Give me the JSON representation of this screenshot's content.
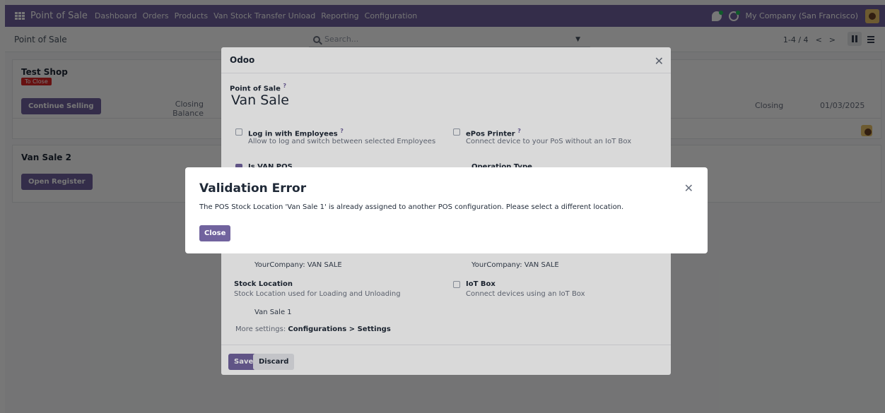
{
  "navbar": {
    "brand": "Point of Sale",
    "menu": [
      "Dashboard",
      "Orders",
      "Products",
      "Van Stock Transfer Unload",
      "Reporting",
      "Configuration"
    ],
    "company": "My Company (San Francisco)"
  },
  "control_panel": {
    "title": "Point of Sale",
    "search_placeholder": "Search...",
    "pager": "1-4 / 4"
  },
  "kanban": {
    "card1": {
      "name": "Test Shop",
      "badge": "To Close",
      "button": "Continue Selling",
      "closing_balance": "Closing Balance",
      "closing": "Closing",
      "date": "01/03/2025"
    },
    "card2": {
      "name": "Van Sale 2",
      "button": "Open Register"
    }
  },
  "form_dialog": {
    "title": "Odoo",
    "field_label": "Point of Sale",
    "name": "Van Sale",
    "options": {
      "log_in_title": "Log in with Employees",
      "log_in_desc": "Allow to log and switch between selected Employees",
      "epos_title": "ePos Printer",
      "epos_desc": "Connect device to your PoS without an IoT Box",
      "is_van_pos": "Is VAN POS",
      "operation_type": "Operation Type",
      "stock_location_title": "Stock Location",
      "stock_location_desc": "Stock Location used for Loading and Unloading",
      "iot_title": "IoT Box",
      "iot_desc": "Connect devices using an IoT Box"
    },
    "left_value": "YourCompany: VAN SALE",
    "right_value": "YourCompany: VAN SALE",
    "stock_location_value": "Van Sale 1",
    "more_settings_prefix": "More settings:",
    "more_settings_link": "Configurations > Settings",
    "save": "Save",
    "discard": "Discard"
  },
  "error_dialog": {
    "title": "Validation Error",
    "message": "The POS Stock Location 'Van Sale 1' is already assigned to another POS configuration. Please select a different location.",
    "close": "Close"
  },
  "colors": {
    "brand": "#71639e",
    "danger": "#dc2626"
  }
}
